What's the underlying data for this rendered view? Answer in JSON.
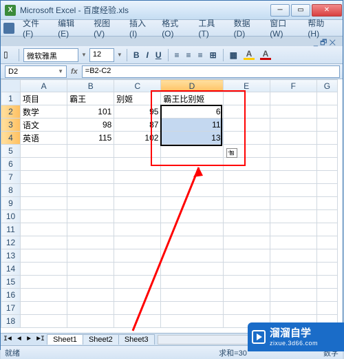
{
  "titlebar": {
    "app_icon_text": "X",
    "title": "Microsoft Excel - 百度经验.xls"
  },
  "menu": {
    "file": "文件(F)",
    "edit": "编辑(E)",
    "view": "视图(V)",
    "insert": "插入(I)",
    "format": "格式(O)",
    "tools": "工具(T)",
    "data": "数据(D)",
    "window": "窗口(W)",
    "help": "帮助(H)",
    "ask": "_ 🗗 ✕"
  },
  "toolbar": {
    "font": "微软雅黑",
    "size": "12",
    "bold": "B",
    "italic": "I",
    "underline": "U"
  },
  "formula": {
    "name_box": "D2",
    "formula_text": "=B2-C2"
  },
  "columns": [
    "A",
    "B",
    "C",
    "D",
    "E",
    "F",
    "G"
  ],
  "rows": [
    "1",
    "2",
    "3",
    "4",
    "5",
    "6",
    "7",
    "8",
    "9",
    "10",
    "11",
    "12",
    "13",
    "14",
    "15",
    "16",
    "17",
    "18"
  ],
  "cells": {
    "A1": "项目",
    "B1": "霸王",
    "C1": "别姬",
    "D1": "霸王比别姬",
    "A2": "数学",
    "B2": "101",
    "C2": "95",
    "D2": "6",
    "A3": "语文",
    "B3": "98",
    "C3": "87",
    "D3": "11",
    "A4": "英语",
    "B4": "115",
    "C4": "102",
    "D4": "13"
  },
  "tabs": {
    "s1": "Sheet1",
    "s2": "Sheet2",
    "s3": "Sheet3"
  },
  "statusbar": {
    "ready": "就绪",
    "sum": "求和=30",
    "num": "数字"
  },
  "watermark": {
    "brand": "溜溜自学",
    "url": "zixue.3d66.com"
  }
}
